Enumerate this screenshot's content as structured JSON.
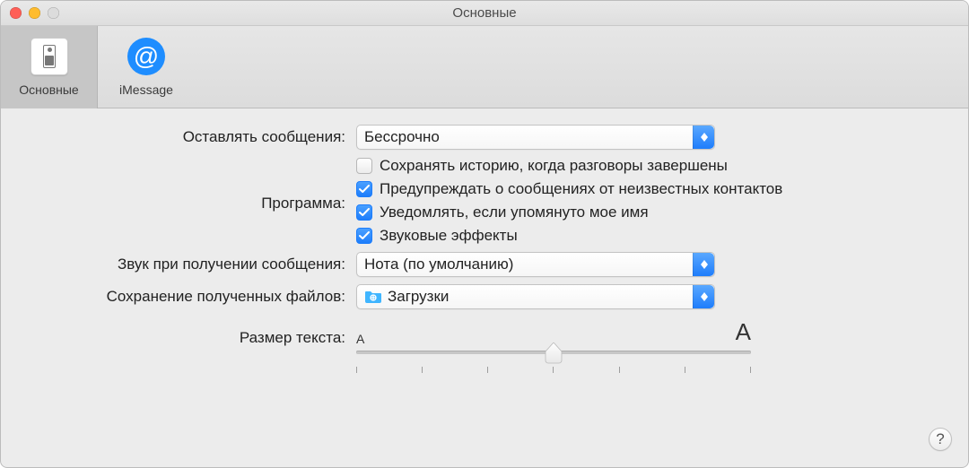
{
  "window": {
    "title": "Основные"
  },
  "tabs": {
    "general": "Основные",
    "imessage": "iMessage"
  },
  "labels": {
    "keep_messages": "Оставлять сообщения:",
    "application": "Программа:",
    "sound_received": "Звук при получении сообщения:",
    "save_files": "Сохранение полученных файлов:",
    "text_size": "Размер текста:"
  },
  "selects": {
    "keep_messages_value": "Бессрочно",
    "sound_value": "Нота (по умолчанию)",
    "save_files_value": "Загрузки"
  },
  "checkboxes": {
    "save_history": {
      "label": "Сохранять историю, когда разговоры завершены",
      "checked": false
    },
    "warn_unknown": {
      "label": "Предупреждать о сообщениях от неизвестных контактов",
      "checked": true
    },
    "notify_mention": {
      "label": "Уведомлять, если упомянуто мое имя",
      "checked": true
    },
    "sound_effects": {
      "label": "Звуковые эффекты",
      "checked": true
    }
  },
  "slider": {
    "small_label": "A",
    "large_label": "A",
    "positions": 7,
    "value_index": 3
  },
  "help": "?"
}
